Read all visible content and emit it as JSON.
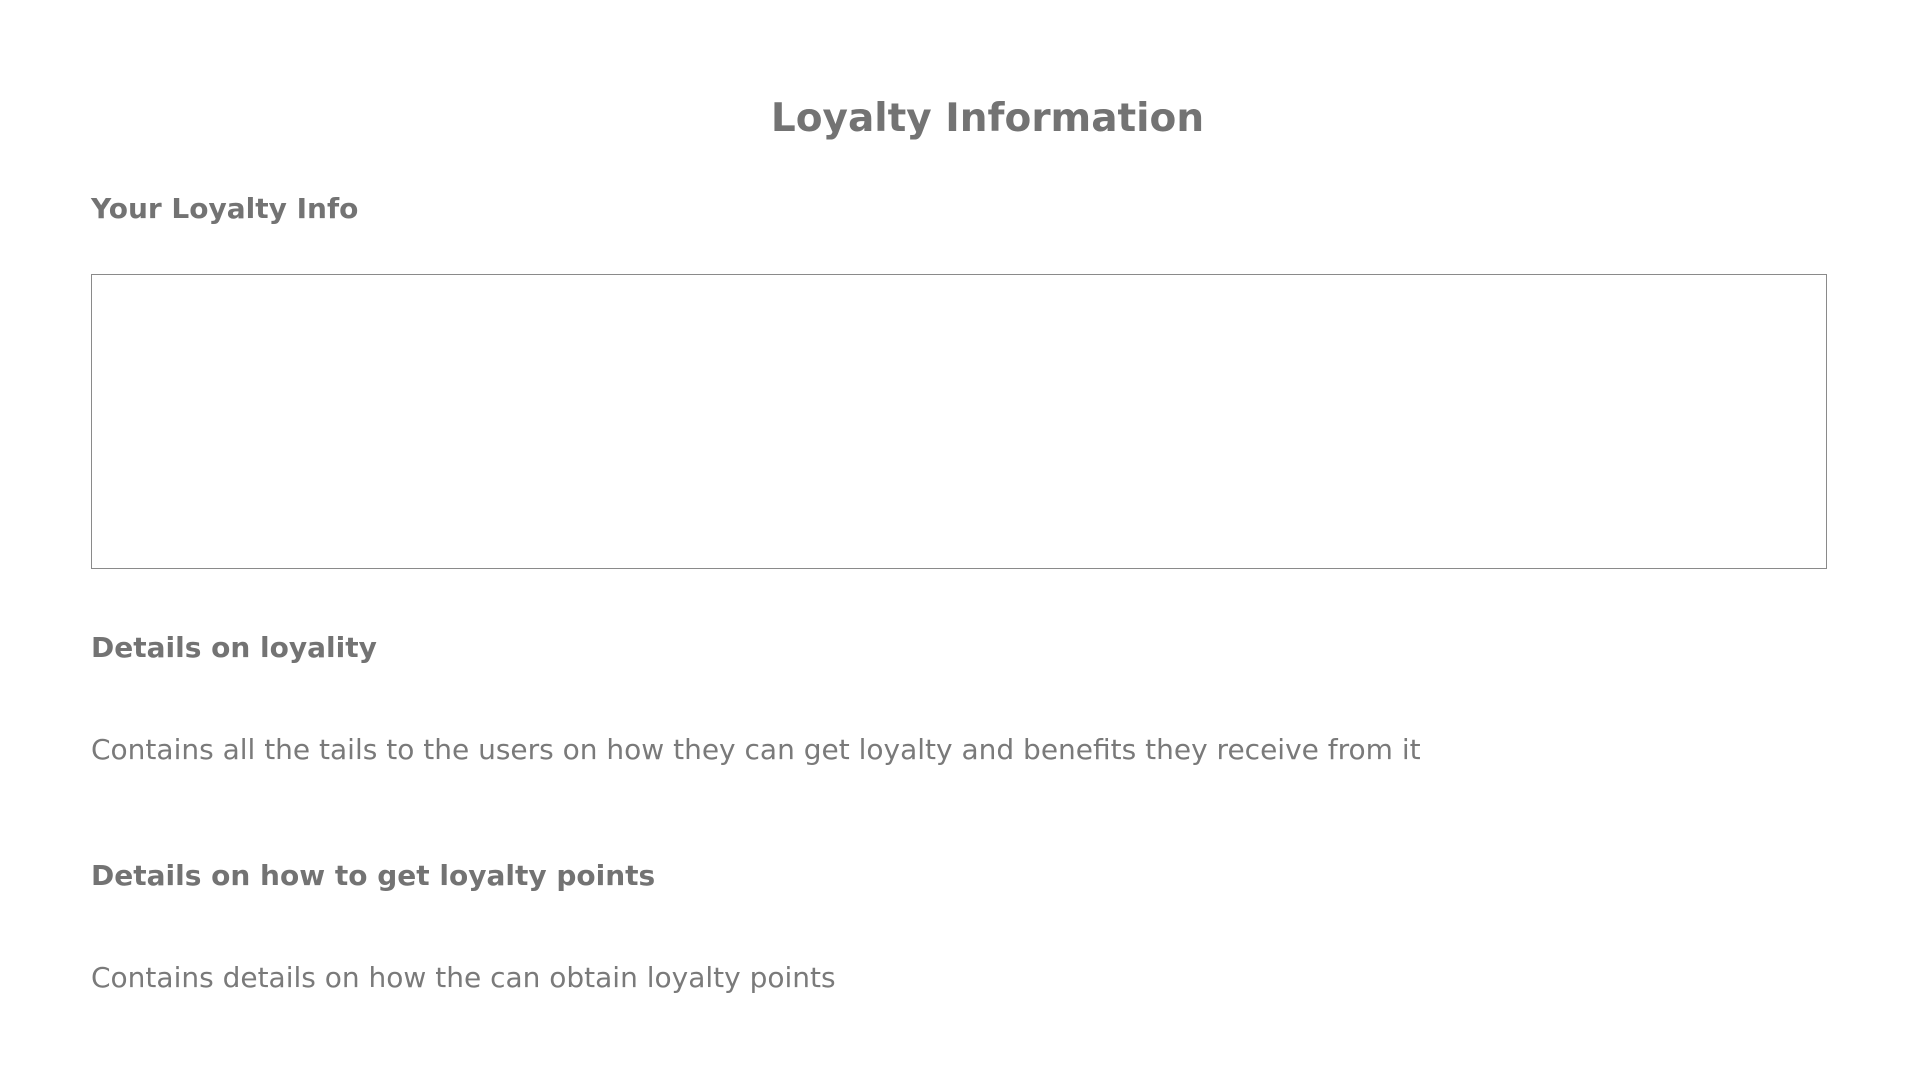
{
  "page": {
    "title": "Loyalty Information"
  },
  "sections": [
    {
      "heading": "Your Loyalty Info"
    },
    {
      "heading": "Details on loyality",
      "text": "Contains all the tails to the users on how they can get loyalty and benefits they receive from it"
    },
    {
      "heading": "Details on how to get loyalty points",
      "text": "Contains details on how the can obtain loyalty points"
    }
  ],
  "colors": {
    "text": "#757575",
    "border": "#8a8a8a",
    "background": "#ffffff"
  }
}
